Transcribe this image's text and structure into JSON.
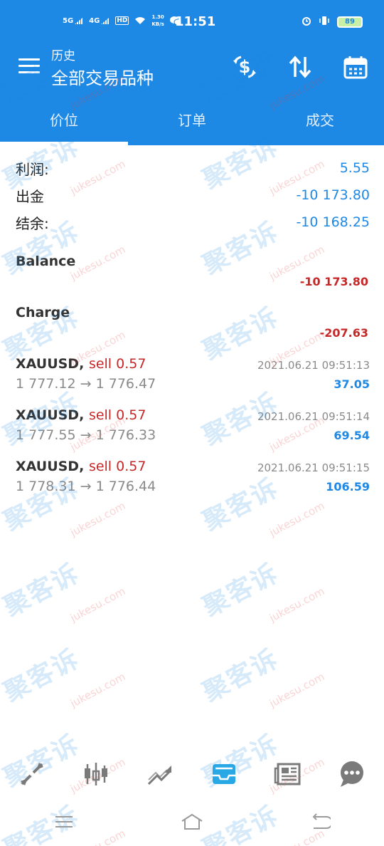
{
  "status_bar": {
    "signal1": "5G",
    "signal2": "4G",
    "hd": "HD",
    "net_speed_value": "1.30",
    "net_speed_unit": "KB/s",
    "time": "11:51",
    "battery": "89"
  },
  "app_bar": {
    "subtitle": "历史",
    "title": "全部交易品种",
    "icons": [
      "menu-icon",
      "dollar-transfer-icon",
      "sort-icon",
      "calendar-icon"
    ]
  },
  "tabs": [
    {
      "label": "价位",
      "active": true
    },
    {
      "label": "订单",
      "active": false
    },
    {
      "label": "成交",
      "active": false
    }
  ],
  "summary": {
    "profit_label": "利润:",
    "profit_value": "5.55",
    "withdrawal_label": "出金",
    "withdrawal_value": "-10 173.80",
    "balance_label": "结余:",
    "balance_value": "-10 168.25"
  },
  "balance_entry": {
    "title": "Balance",
    "amount": "-10 173.80"
  },
  "charge_entry": {
    "title": "Charge",
    "amount": "-207.63"
  },
  "deals": [
    {
      "symbol": "XAUUSD,",
      "side": "sell 0.57",
      "prices": "1 777.12 → 1 776.47",
      "time": "2021.06.21 09:51:13",
      "profit": "37.05"
    },
    {
      "symbol": "XAUUSD,",
      "side": "sell 0.57",
      "prices": "1 777.55 → 1 776.33",
      "time": "2021.06.21 09:51:14",
      "profit": "69.54"
    },
    {
      "symbol": "XAUUSD,",
      "side": "sell 0.57",
      "prices": "1 778.31 → 1 776.44",
      "time": "2021.06.21 09:51:15",
      "profit": "106.59"
    }
  ],
  "watermark": {
    "cn": "聚客诉",
    "en": "jukesu.com"
  },
  "bottom_nav": [
    "quotes-icon",
    "chart-candles-icon",
    "trade-icon",
    "history-icon",
    "news-icon",
    "chat-icon"
  ],
  "colors": {
    "primary": "#1e88e5",
    "negative": "#c62828",
    "active_nav": "#29a8e6"
  }
}
